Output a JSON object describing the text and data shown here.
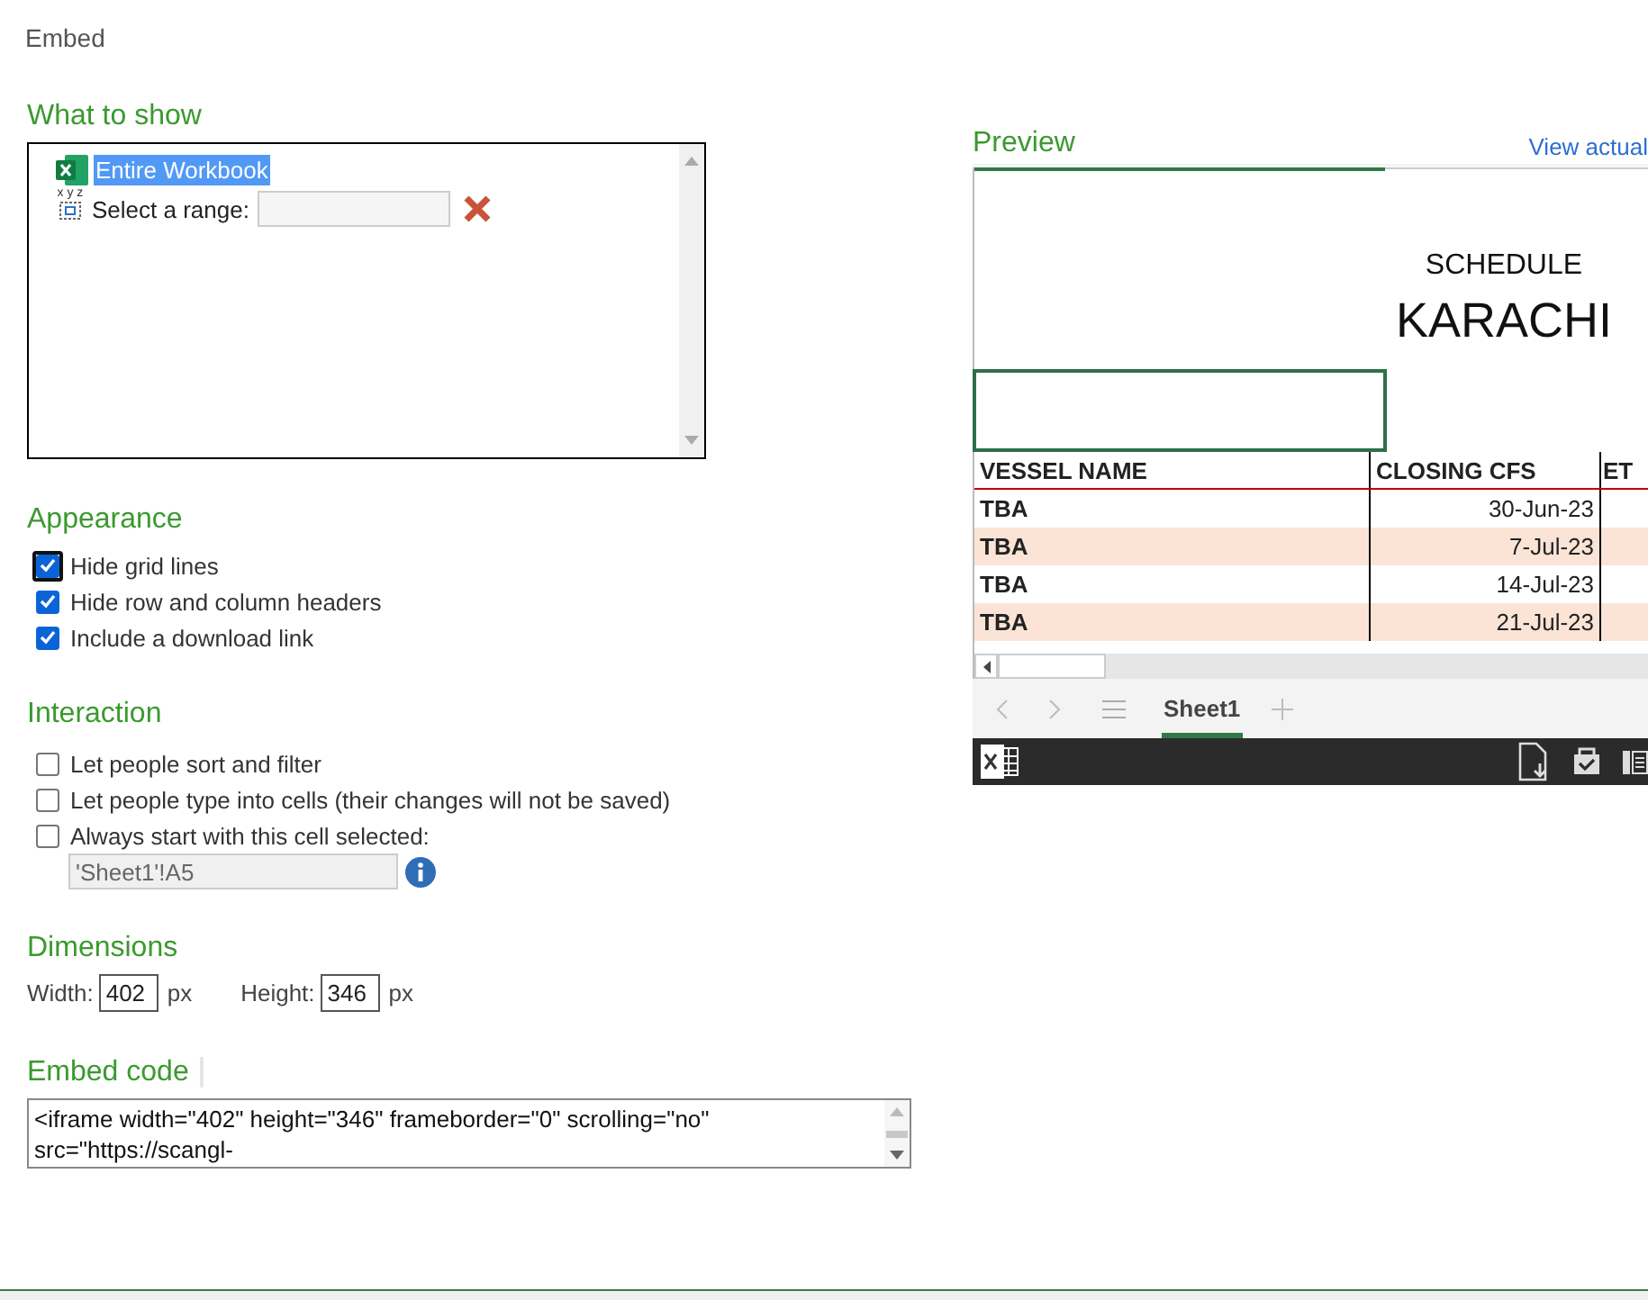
{
  "dialog": {
    "title": "Embed"
  },
  "what_to_show": {
    "heading": "What to show",
    "items": [
      {
        "kind": "workbook",
        "label": "Entire Workbook",
        "selected": true
      },
      {
        "kind": "range",
        "icon_text": "x y z",
        "label": "Select a range:",
        "selected": false
      }
    ]
  },
  "appearance": {
    "heading": "Appearance",
    "options": [
      {
        "label": "Hide grid lines",
        "checked": true,
        "focused": true
      },
      {
        "label": "Hide row and column headers",
        "checked": true,
        "focused": false
      },
      {
        "label": "Include a download link",
        "checked": true,
        "focused": false
      }
    ]
  },
  "interaction": {
    "heading": "Interaction",
    "options": [
      {
        "label": "Let people sort and filter",
        "checked": false
      },
      {
        "label": "Let people type into cells (their changes will not be saved)",
        "checked": false
      },
      {
        "label": "Always start with this cell selected:",
        "checked": false
      }
    ],
    "cell_field": {
      "value": "'Sheet1'!A5"
    }
  },
  "dimensions": {
    "heading": "Dimensions",
    "width_label": "Width:",
    "width_value": "402",
    "width_unit": "px",
    "height_label": "Height:",
    "height_value": "346",
    "height_unit": "px"
  },
  "embed_code": {
    "heading": "Embed code",
    "value": "<iframe width=\"402\" height=\"346\" frameborder=\"0\" scrolling=\"no\" src=\"https://scangl-"
  },
  "preview": {
    "heading": "Preview",
    "link": "View actual",
    "sheet": {
      "subtitle": "SCHEDULE",
      "title": "KARACHI",
      "columns": [
        "VESSEL NAME",
        "CLOSING CFS",
        "ET"
      ],
      "rows": [
        {
          "cells": [
            "TBA",
            "30-Jun-23"
          ],
          "shaded": false
        },
        {
          "cells": [
            "TBA",
            "7-Jul-23"
          ],
          "shaded": true
        },
        {
          "cells": [
            "TBA",
            "14-Jul-23"
          ],
          "shaded": false
        },
        {
          "cells": [
            "TBA",
            "21-Jul-23"
          ],
          "shaded": true
        }
      ]
    },
    "tabs": [
      {
        "label": "Sheet1",
        "selected": true
      }
    ]
  }
}
